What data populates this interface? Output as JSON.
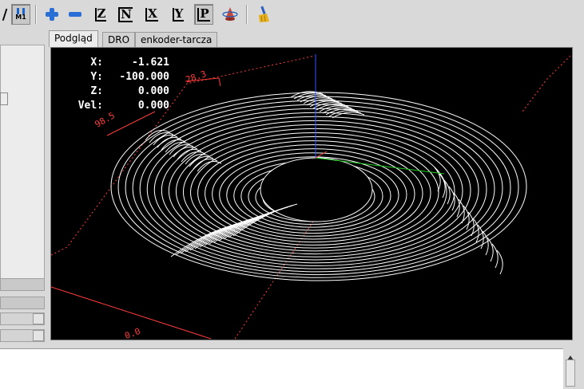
{
  "toolbar": {
    "buttons": [
      "slash-toggle",
      "m1-toggle",
      "zoom-in",
      "zoom-out",
      "view-z",
      "view-z2",
      "view-x",
      "view-y",
      "view-p",
      "rotate-view",
      "clear-plot"
    ],
    "axis_labels": {
      "z": "Z",
      "z2": "N",
      "x": "X",
      "y": "Y",
      "p": "P"
    },
    "m1_label": "M1"
  },
  "tabs": [
    {
      "label": "Podgląd",
      "active": true
    },
    {
      "label": "DRO",
      "active": false
    },
    {
      "label": "enkoder-tarcza",
      "active": false
    }
  ],
  "dro": {
    "x_label": "X:",
    "x_value": "-1.621",
    "y_label": "Y:",
    "y_value": "-100.000",
    "z_label": "Z:",
    "z_value": "0.000",
    "vel_label": "Vel:",
    "vel_value": "0.000"
  },
  "dimensions": {
    "left_dim": "98.5",
    "top_dim": "28.3",
    "bottom_dim": "0.0"
  },
  "colors": {
    "background": "#000000",
    "toolpath": "#ffffff",
    "limit_box": "#ff3b3b",
    "axis_x": "#ff3b3b",
    "axis_y": "#22cc22",
    "axis_z": "#3355ff"
  }
}
